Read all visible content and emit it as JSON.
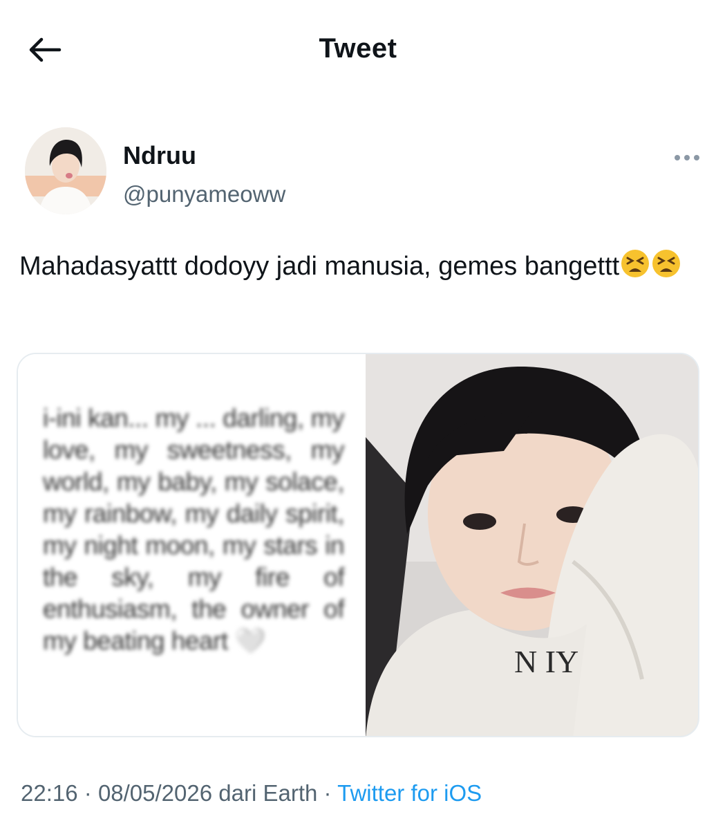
{
  "header": {
    "title": "Tweet",
    "back_icon": "arrow-left-icon"
  },
  "author": {
    "display_name": "Ndruu",
    "handle": "@punyameoww",
    "more_icon": "more-horizontal-icon"
  },
  "tweet": {
    "text": "Mahadasyattt dodoyy jadi manusia, gemes bangettt",
    "emojis": [
      "tired-face-emoji",
      "tired-face-emoji"
    ]
  },
  "media": {
    "left_text": "i-ini kan... my ... darling, my love, my sweetness, my world, my baby, my solace, my rainbow, my daily spirit, my night moon, my stars in the sky, my fire of enthusiasm, the owner of my beating heart 🤍",
    "right_shirt_letters": "N IY"
  },
  "meta": {
    "time": "22:16",
    "separator": "·",
    "date": "08/05/2026",
    "from_label": "dari Earth",
    "source": "Twitter for iOS"
  },
  "colors": {
    "text": "#0f1419",
    "secondary": "#536471",
    "accent": "#1d9bf0",
    "border": "#e6ecf0"
  }
}
